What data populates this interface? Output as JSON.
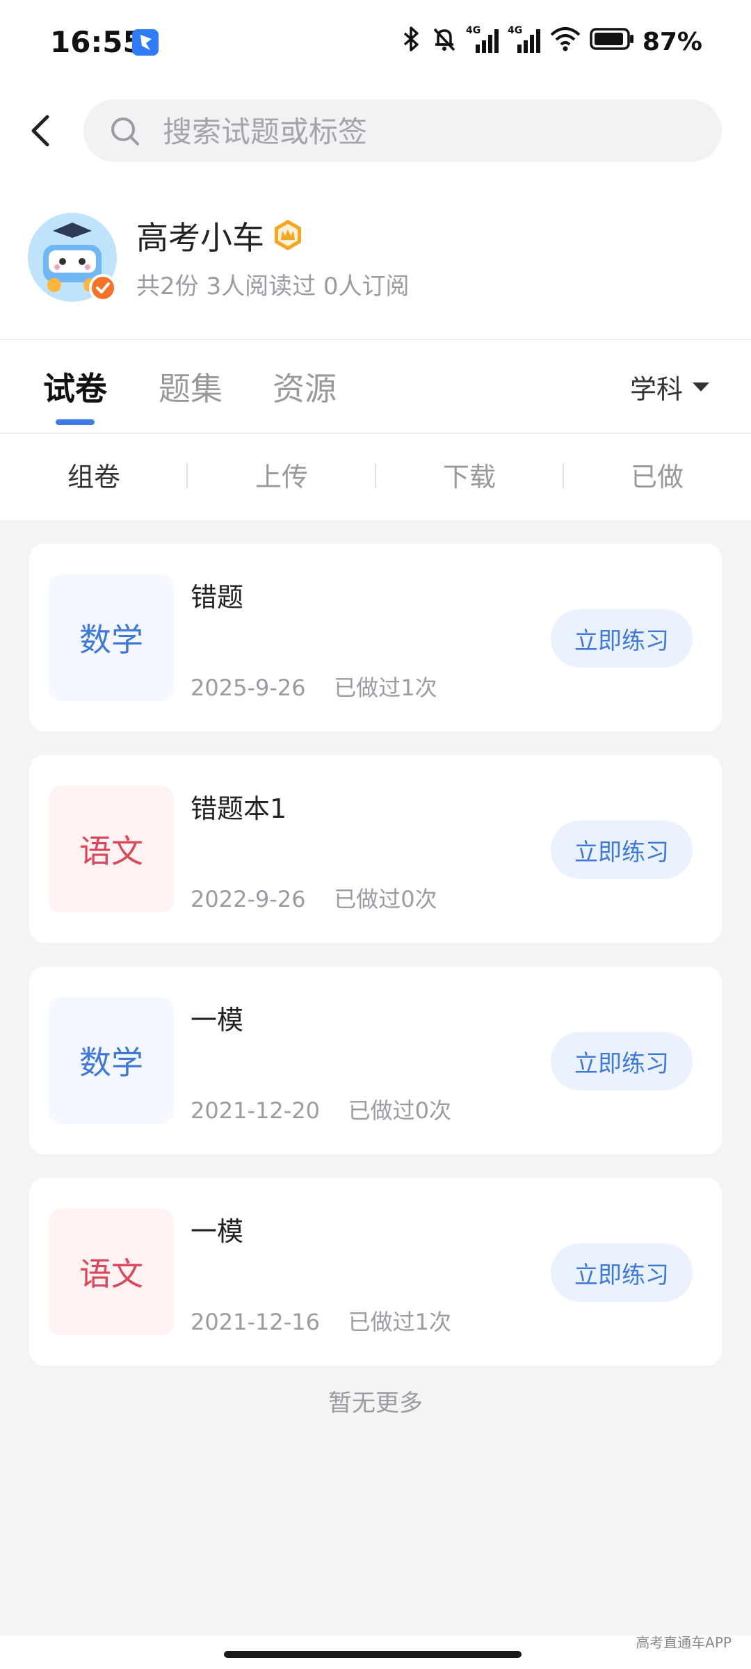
{
  "status_bar": {
    "time": "16:55",
    "battery": "87%",
    "icons": [
      "app-notification-icon",
      "bluetooth-icon",
      "mute-icon",
      "signal-4g-icon",
      "signal-4g-icon",
      "wifi-icon",
      "battery-icon"
    ],
    "network_label": "4G"
  },
  "search": {
    "placeholder": "搜索试题或标签",
    "value": ""
  },
  "profile": {
    "name": "高考小车",
    "stats": "共2份 3人阅读过 0人订阅"
  },
  "tabs": [
    {
      "label": "试卷",
      "active": true
    },
    {
      "label": "题集",
      "active": false
    },
    {
      "label": "资源",
      "active": false
    }
  ],
  "subject_filter": "学科",
  "subtabs": [
    {
      "label": "组卷",
      "active": true
    },
    {
      "label": "上传",
      "active": false
    },
    {
      "label": "下载",
      "active": false
    },
    {
      "label": "已做",
      "active": false
    }
  ],
  "papers": [
    {
      "subject": "数学",
      "title": "错题",
      "date": "2025-9-26",
      "done": "已做过1次",
      "button": "立即练习"
    },
    {
      "subject": "语文",
      "title": "错题本1",
      "date": "2022-9-26",
      "done": "已做过0次",
      "button": "立即练习"
    },
    {
      "subject": "数学",
      "title": "一模",
      "date": "2021-12-20",
      "done": "已做过0次",
      "button": "立即练习"
    },
    {
      "subject": "语文",
      "title": "一模",
      "date": "2021-12-16",
      "done": "已做过1次",
      "button": "立即练习"
    }
  ],
  "footer_text": "暂无更多",
  "watermark": "高考直通车APP",
  "colors": {
    "accent": "#3e7be8",
    "math_text": "#3f78d7",
    "chinese_text": "#d9485b",
    "button_bg": "#eaf2fe",
    "page_bg": "#f4f4f5"
  }
}
